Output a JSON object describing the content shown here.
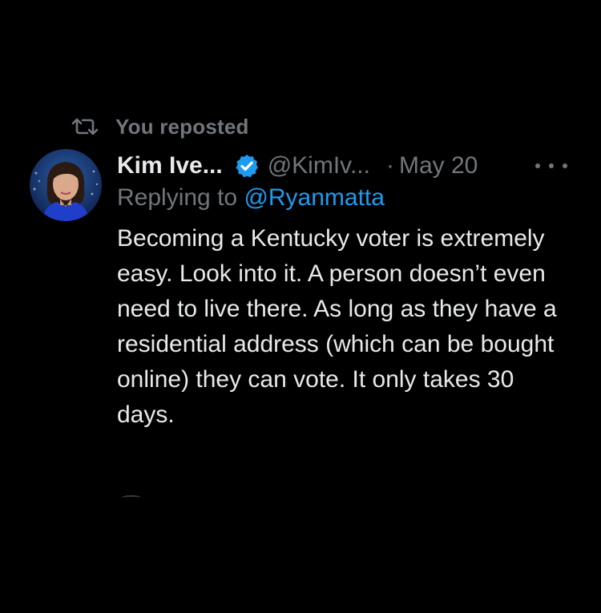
{
  "repost": {
    "label": "You reposted",
    "icon": "repost-icon"
  },
  "tweet": {
    "author_name": "Kim Ive...",
    "verified": true,
    "handle": "@KimIv...",
    "separator": "·",
    "date": "May 20",
    "reply_prefix": "Replying to",
    "reply_to_handle": "@Ryanmatta",
    "text": "Becoming a Kentucky voter is extremely easy. Look into it. A person doesn’t even need to live there. As long as they have a residential address (which can be bought online) they can vote. It only takes 30 days."
  },
  "icons": {
    "verified": "verified-badge-icon",
    "more": "more-options-icon",
    "avatar": "avatar"
  },
  "colors": {
    "background": "#000000",
    "primary_text": "#e7e9ea",
    "secondary_text": "#71767b",
    "link": "#1d9bf0",
    "verified_badge": "#1d9bf0"
  }
}
